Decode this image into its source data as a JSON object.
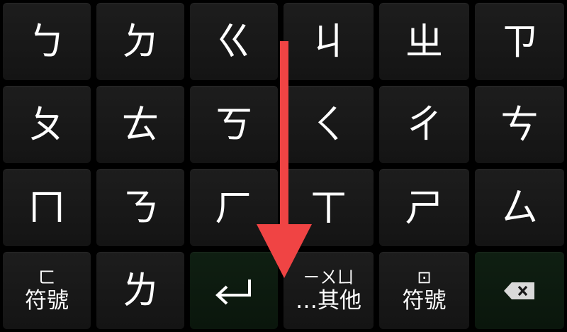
{
  "keyboard": {
    "rows": [
      [
        {
          "name": "key-bo",
          "label": "ㄅ"
        },
        {
          "name": "key-de",
          "label": "ㄉ"
        },
        {
          "name": "key-ge",
          "label": "ㄍ"
        },
        {
          "name": "key-ji",
          "label": "ㄐ"
        },
        {
          "name": "key-zhi",
          "label": "ㄓ"
        },
        {
          "name": "key-zi",
          "label": "ㄗ"
        }
      ],
      [
        {
          "name": "key-po",
          "label": "ㄆ"
        },
        {
          "name": "key-te",
          "label": "ㄊ"
        },
        {
          "name": "key-ke",
          "label": "ㄎ"
        },
        {
          "name": "key-qi",
          "label": "ㄑ"
        },
        {
          "name": "key-chi",
          "label": "ㄔ"
        },
        {
          "name": "key-ci",
          "label": "ㄘ"
        }
      ],
      [
        {
          "name": "key-mo",
          "label": "ㄇ"
        },
        {
          "name": "key-ne",
          "label": "ㄋ"
        },
        {
          "name": "key-he",
          "label": "ㄏ"
        },
        {
          "name": "key-xi",
          "label": "ㄒ"
        },
        {
          "name": "key-shi",
          "label": "ㄕ"
        },
        {
          "name": "key-si",
          "label": "ㄙ"
        }
      ]
    ],
    "bottom": {
      "symbols1": {
        "top": "ㄈ",
        "bottom": "符號"
      },
      "le": "ㄌ",
      "enter_icon": "enter-icon",
      "others": {
        "top": "ㄧㄨㄩ",
        "bottom": "…其他"
      },
      "symbols2": {
        "top": "⊡",
        "bottom": "符號"
      },
      "backspace_icon": "backspace-icon"
    }
  },
  "overlay": {
    "arrow_color": "#f04444",
    "arrow_direction": "down"
  },
  "colors": {
    "key_bg": "#1a1a1a",
    "key_bg_accent": "#0d1b10",
    "background": "#000000",
    "text": "#ffffff"
  }
}
